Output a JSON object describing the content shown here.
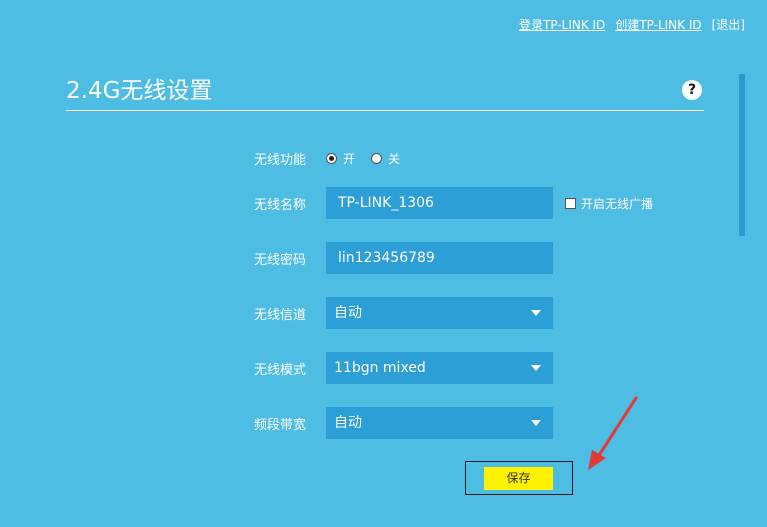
{
  "header": {
    "login_link": "登录TP-LINK ID",
    "create_link": "创建TP-LINK ID",
    "logout_link": "[退出]"
  },
  "panel": {
    "title": "2.4G无线设置",
    "help_icon": "?"
  },
  "form": {
    "wireless_function": {
      "label": "无线功能",
      "on_label": "开",
      "off_label": "关",
      "selected": "on"
    },
    "ssid": {
      "label": "无线名称",
      "value": "TP-LINK_1306",
      "broadcast_label": "开启无线广播"
    },
    "password": {
      "label": "无线密码",
      "value": "lin123456789"
    },
    "channel": {
      "label": "无线信道",
      "value": "自动"
    },
    "mode": {
      "label": "无线模式",
      "value": "11bgn mixed"
    },
    "bandwidth": {
      "label": "频段带宽",
      "value": "自动"
    }
  },
  "actions": {
    "save_label": "保存"
  },
  "colors": {
    "background": "#4dbde3",
    "field": "#2b9fd6",
    "save": "#fff200",
    "arrow": "#e53935"
  }
}
